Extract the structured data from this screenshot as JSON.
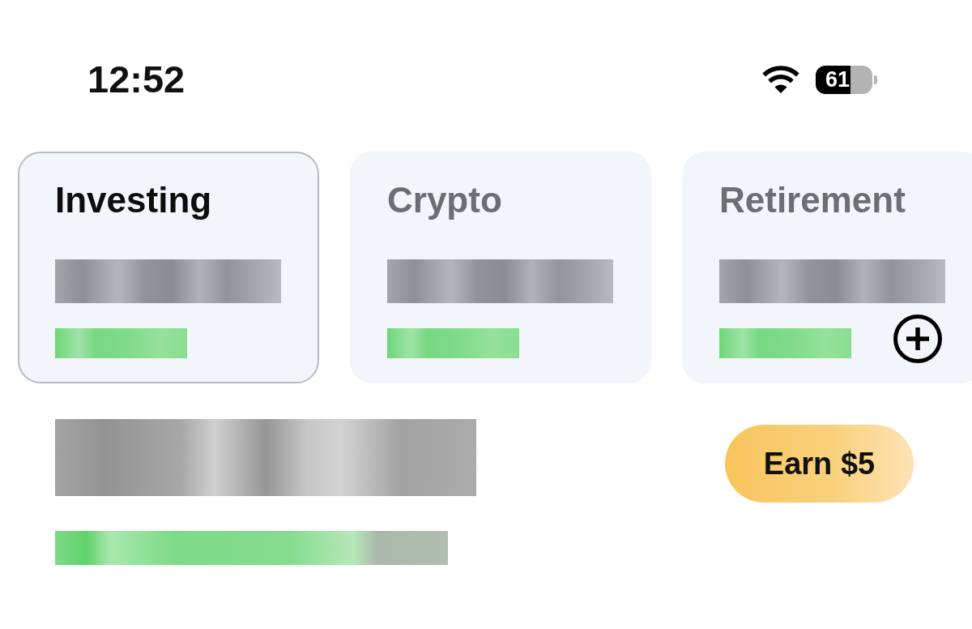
{
  "status_bar": {
    "time": "12:52",
    "battery": "61"
  },
  "accounts": [
    {
      "label": "Investing",
      "selected": true
    },
    {
      "label": "Crypto",
      "selected": false
    },
    {
      "label": "Retirement",
      "selected": false
    }
  ],
  "earn_button": {
    "label": "Earn $5"
  }
}
